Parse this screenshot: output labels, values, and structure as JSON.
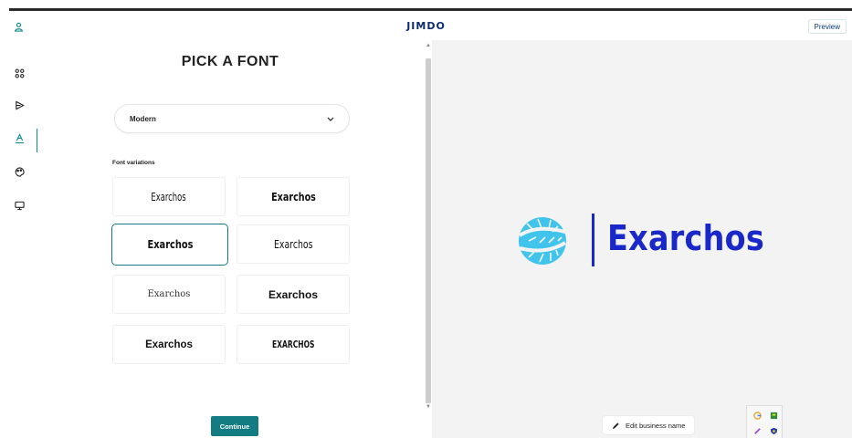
{
  "header": {
    "brand": "JIMDO",
    "preview_label": "Preview"
  },
  "sidebar": {
    "items": [
      {
        "icon": "grid-icon",
        "active": false
      },
      {
        "icon": "brush-icon",
        "active": false
      },
      {
        "icon": "typography-icon",
        "active": true
      },
      {
        "icon": "palette-icon",
        "active": false
      },
      {
        "icon": "monitor-icon",
        "active": false
      }
    ]
  },
  "panel": {
    "title": "PICK A FONT",
    "style_select": {
      "value": "Modern"
    },
    "variations_label": "Font variations",
    "font_variations": [
      {
        "text": "Exarchos",
        "selected": false
      },
      {
        "text": "Exarchos",
        "selected": false
      },
      {
        "text": "Exarchos",
        "selected": true
      },
      {
        "text": "Exarchos",
        "selected": false
      },
      {
        "text": "Exarchos",
        "selected": false
      },
      {
        "text": "Exarchos",
        "selected": false
      },
      {
        "text": "Exarchos",
        "selected": false
      },
      {
        "text": "EXARCHOS",
        "selected": false
      }
    ],
    "continue_label": "Continue"
  },
  "preview": {
    "logo_text": "Exarchos",
    "edit_business_label": "Edit business name"
  },
  "colors": {
    "accent": "#127c82",
    "brand_navy": "#0c2b6e",
    "logo_blue": "#1a28c9",
    "logo_cyan": "#41c4ec",
    "preview_bg": "#f3f3f3"
  }
}
